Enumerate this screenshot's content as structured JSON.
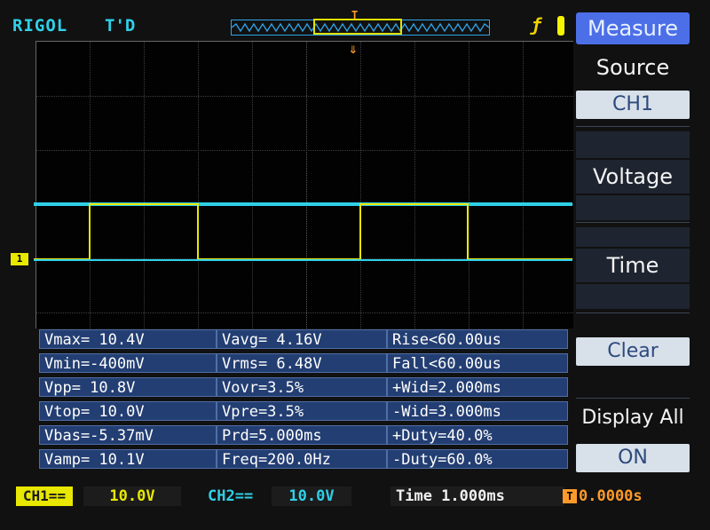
{
  "header": {
    "brand": "RIGOL",
    "trigger_status": "T'D",
    "trigger_edge_icon": "rising-edge-icon"
  },
  "colors": {
    "ch1": "#e8e800",
    "ch2": "#2fd0e8",
    "trigger": "#ff9a2a",
    "menu_accent": "#4c6fe8",
    "meas_bg": "#233e72"
  },
  "markers": {
    "ch1": "1",
    "trigger_top": "T",
    "trigger_pos": "⇓"
  },
  "measurements": [
    [
      "Vmax= 10.4V",
      "Vavg= 4.16V",
      "Rise<60.00us"
    ],
    [
      "Vmin=-400mV",
      "Vrms= 6.48V",
      "Fall<60.00us"
    ],
    [
      "Vpp= 10.8V",
      "Vovr=3.5%",
      "+Wid=2.000ms"
    ],
    [
      "Vtop= 10.0V",
      "Vpre=3.5%",
      "-Wid=3.000ms"
    ],
    [
      "Vbas=-5.37mV",
      "Prd=5.000ms",
      "+Duty=40.0%"
    ],
    [
      "Vamp= 10.1V",
      "Freq=200.0Hz",
      "-Duty=60.0%"
    ]
  ],
  "status": {
    "ch1_label": "CH1==",
    "ch1_scale": "10.0V",
    "ch2_label": "CH2==",
    "ch2_scale": "10.0V",
    "time": "Time 1.000ms",
    "trigger_offset": "0.0000s",
    "trigger_badge": "T"
  },
  "menu": {
    "title": "Measure",
    "source_label": "Source",
    "source_value": "CH1",
    "voltage_label": "Voltage",
    "time_label": "Time",
    "clear_label": "Clear",
    "display_all_label": "Display All",
    "display_all_value": "ON"
  }
}
